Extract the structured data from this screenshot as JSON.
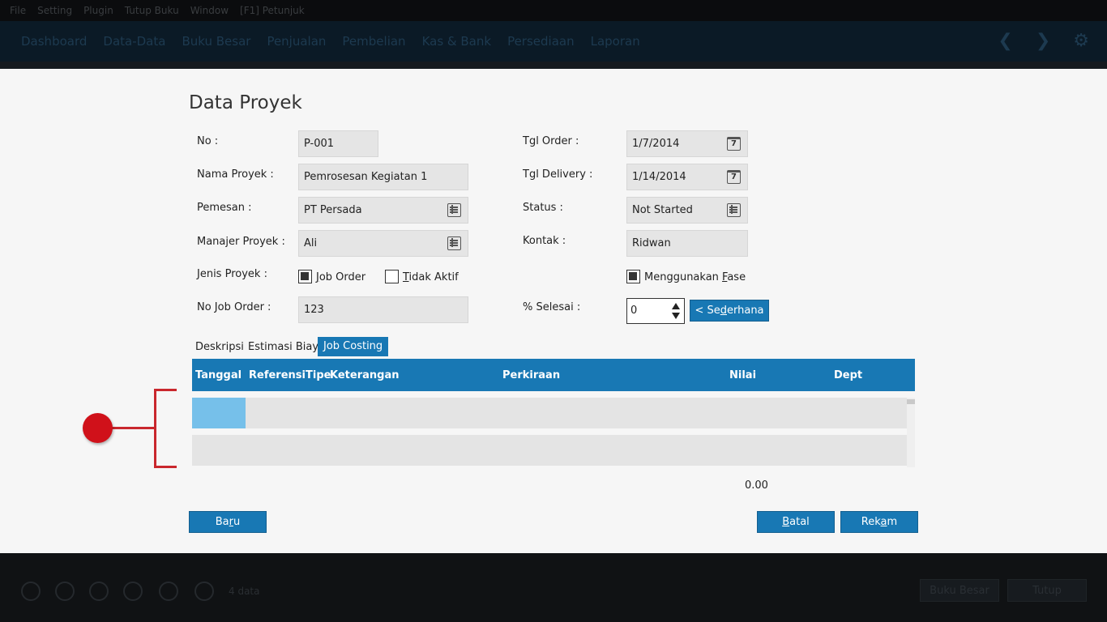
{
  "menubar": {
    "items": [
      "File",
      "Setting",
      "Plugin",
      "Tutup Buku",
      "Window",
      "[F1] Petunjuk"
    ]
  },
  "nav": {
    "items": [
      "Dashboard",
      "Data-Data",
      "Buku Besar",
      "Penjualan",
      "Pembelian",
      "Kas & Bank",
      "Persediaan",
      "Laporan"
    ]
  },
  "form": {
    "title": "Data Proyek",
    "no_label": "No :",
    "no_value": "P-001",
    "nama_label": "Nama Proyek :",
    "nama_value": "Pemrosesan Kegiatan 1",
    "pemesan_label": "Pemesan :",
    "pemesan_value": "PT Persada",
    "manajer_label": "Manajer Proyek :",
    "manajer_value": "Ali",
    "jenis_label": "Jenis Proyek :",
    "job_order_first": "J",
    "job_order_rest": "ob Order",
    "tidak_aktif_first": "T",
    "tidak_aktif_rest": "idak Aktif",
    "nojob_label": "No Job Order :",
    "nojob_value": "123",
    "tgl_order_label": "Tgl Order :",
    "tgl_order_value": "1/7/2014",
    "tgl_delivery_label": "Tgl Delivery :",
    "tgl_delivery_value": "1/14/2014",
    "status_label": "Status :",
    "status_value": "Not Started",
    "kontak_label": "Kontak :",
    "kontak_value": "Ridwan",
    "fase_pre": "Menggunakan ",
    "fase_u": "F",
    "fase_post": "ase",
    "selesai_label": "% Selesai :",
    "selesai_value": "0",
    "sederhana_pre": "< Se",
    "sederhana_u": "d",
    "sederhana_post": "erhana",
    "calendar_day": "7"
  },
  "tabs": [
    "Deskripsi",
    "Estimasi Biaya",
    "Job Costing"
  ],
  "table": {
    "columns": [
      "Tanggal",
      "Referensi",
      "Tipe",
      "Keterangan",
      "Perkiraan",
      "Nilai",
      "Dept"
    ],
    "rows": [
      [],
      []
    ],
    "total": "0.00"
  },
  "buttons": {
    "baru_pre": "Ba",
    "baru_u": "r",
    "baru_post": "u",
    "batal_pre": "",
    "batal_u": "B",
    "batal_post": "atal",
    "rekam_pre": "Rek",
    "rekam_u": "a",
    "rekam_post": "m"
  },
  "bottombar": {
    "count": "4 data",
    "buku_besar": "Buku Besar",
    "tutup": "Tutup"
  },
  "colors": {
    "accent": "#1878b4",
    "selection": "#76c0ea",
    "annotation": "#d0111a"
  }
}
